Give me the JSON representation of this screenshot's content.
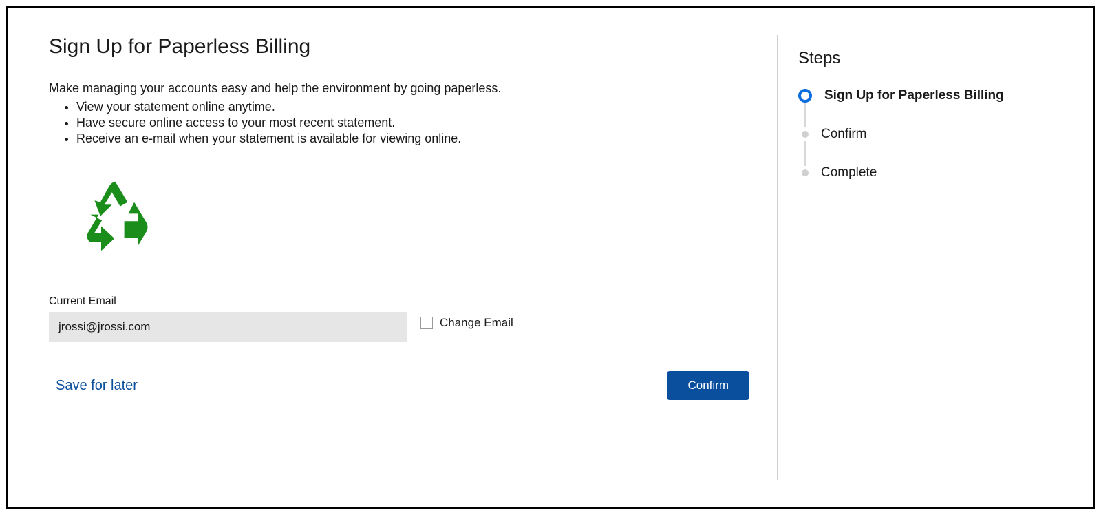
{
  "main": {
    "title": "Sign Up for Paperless Billing",
    "intro": "Make managing your accounts easy and help the environment by going paperless.",
    "bullets": [
      "View your statement online anytime.",
      "Have secure online access to your most recent statement.",
      "Receive an e-mail when your statement is available for viewing online."
    ],
    "email_label": "Current Email",
    "email_value": "jrossi@jrossi.com",
    "change_email_label": "Change Email",
    "save_link": "Save for later",
    "confirm_button": "Confirm"
  },
  "sidebar": {
    "steps_heading": "Steps",
    "steps": [
      {
        "label": "Sign Up for Paperless Billing",
        "active": true
      },
      {
        "label": "Confirm",
        "active": false
      },
      {
        "label": "Complete",
        "active": false
      }
    ]
  },
  "icons": {
    "recycle": "recycle-icon"
  },
  "colors": {
    "primary": "#0a4f9e",
    "step_active": "#0a6de0"
  }
}
